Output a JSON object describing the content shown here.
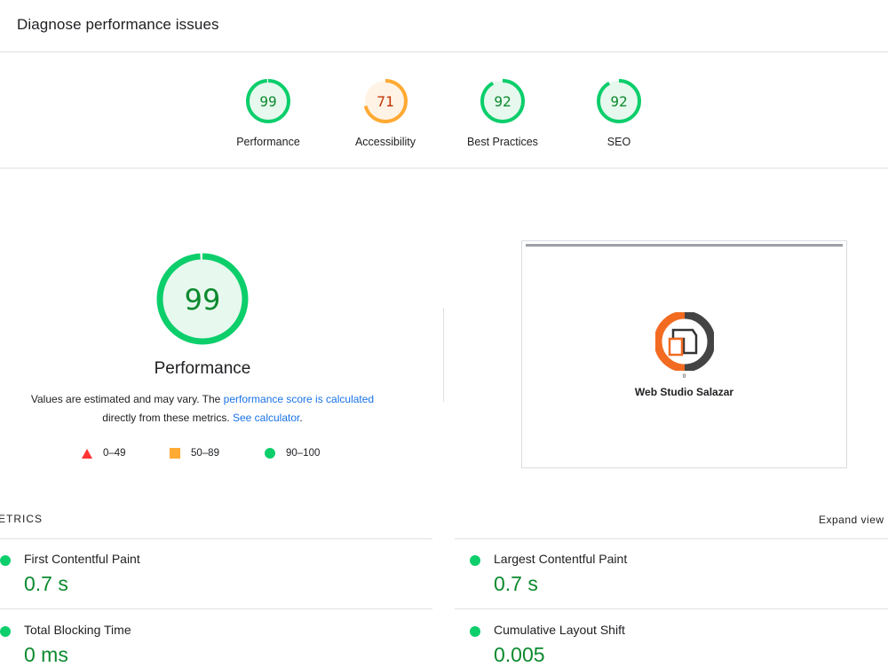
{
  "header": {
    "title": "Diagnose performance issues"
  },
  "scores": [
    {
      "value": "99",
      "label": "Performance",
      "color": "#0cce6b",
      "text_color": "#0c8a2e",
      "bg": "#e7f8ee",
      "fraction": 0.99
    },
    {
      "value": "71",
      "label": "Accessibility",
      "color": "#ffaa33",
      "text_color": "#c33300",
      "bg": "#fff3e6",
      "fraction": 0.71
    },
    {
      "value": "92",
      "label": "Best Practices",
      "color": "#0cce6b",
      "text_color": "#0c8a2e",
      "bg": "#e7f8ee",
      "fraction": 0.92
    },
    {
      "value": "92",
      "label": "SEO",
      "color": "#0cce6b",
      "text_color": "#0c8a2e",
      "bg": "#e7f8ee",
      "fraction": 0.92
    }
  ],
  "main_score": {
    "value": "99",
    "label": "Performance",
    "fraction": 0.99
  },
  "description": {
    "text1": "Values are estimated and may vary. The ",
    "link1": "performance score is calculated",
    "text2": "directly from these metrics. ",
    "link2": "See calculator",
    "text3": "."
  },
  "legend": {
    "fail": "0–49",
    "average": "50–89",
    "pass": "90–100",
    "colors": {
      "fail": "#ff3333",
      "average": "#ffaa33",
      "pass": "#0cce6b"
    }
  },
  "screenshot": {
    "brand": "Web Studio Salazar",
    "mark": "0"
  },
  "metrics": {
    "heading": "ETRICS",
    "expand": "Expand view",
    "items": [
      {
        "name": "First Contentful Paint",
        "value": "0.7 s"
      },
      {
        "name": "Largest Contentful Paint",
        "value": "0.7 s"
      },
      {
        "name": "Total Blocking Time",
        "value": "0 ms"
      },
      {
        "name": "Cumulative Layout Shift",
        "value": "0.005"
      }
    ]
  }
}
